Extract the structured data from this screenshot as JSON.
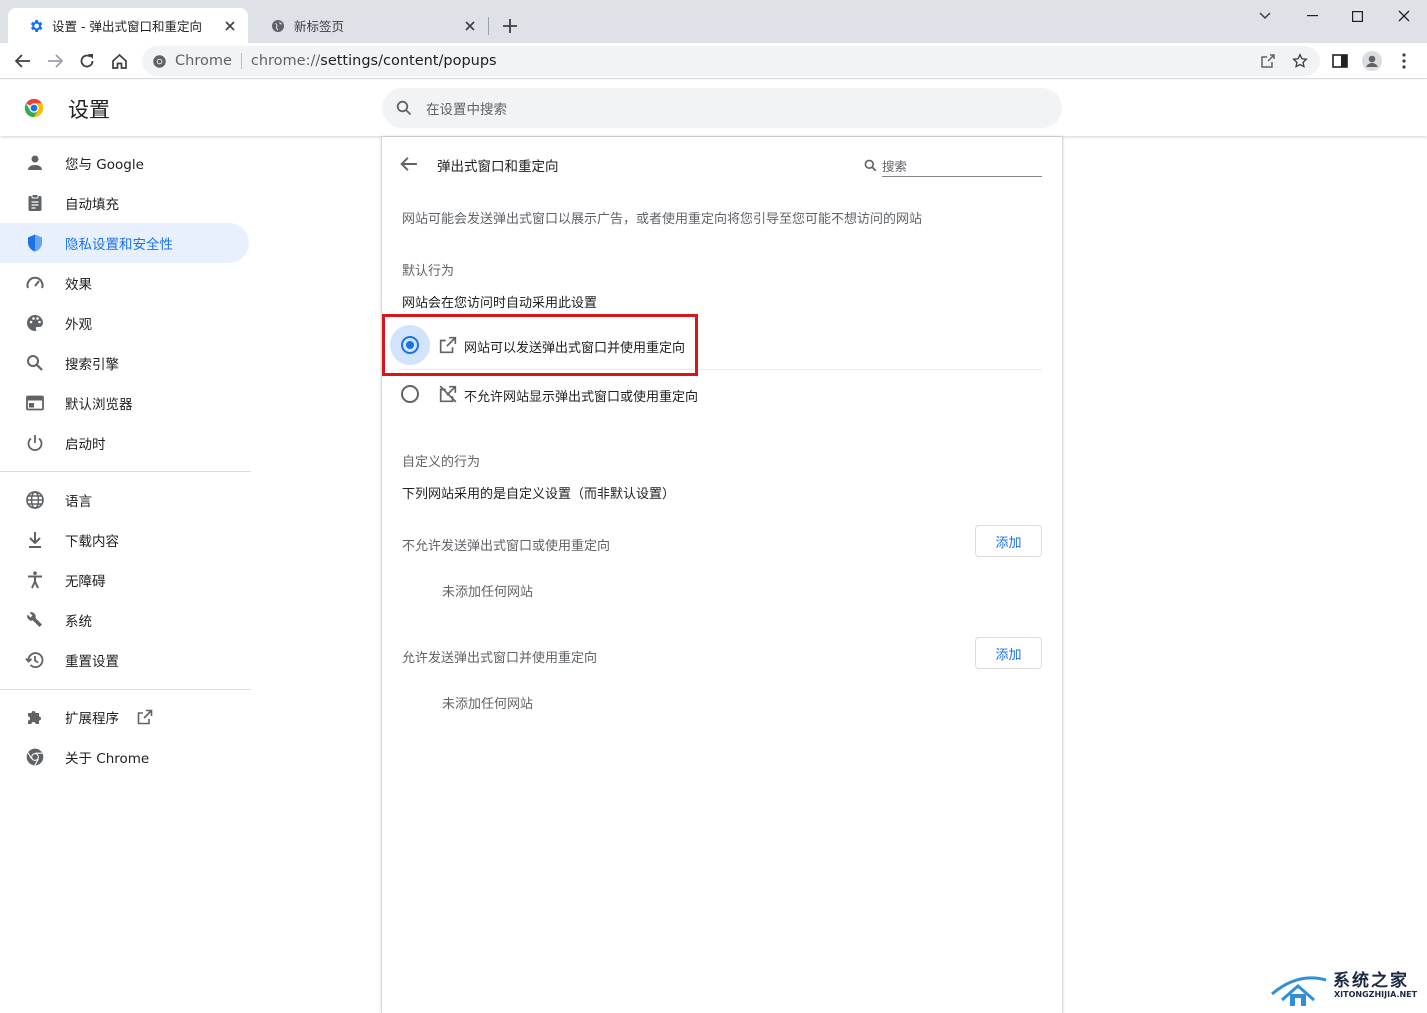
{
  "browser": {
    "tabs": [
      {
        "title": "设置 - 弹出式窗口和重定向",
        "icon": "gear-icon",
        "active": true
      },
      {
        "title": "新标签页",
        "icon": "globe-icon",
        "active": false
      }
    ],
    "omnibox": {
      "site_label": "Chrome",
      "url_prefix": "chrome://",
      "url_path": "settings/content/popups"
    }
  },
  "settings": {
    "title": "设置",
    "search_placeholder": "在设置中搜索"
  },
  "sidebar": {
    "items": [
      {
        "label": "您与 Google",
        "icon": "person-icon"
      },
      {
        "label": "自动填充",
        "icon": "clipboard-icon"
      },
      {
        "label": "隐私设置和安全性",
        "icon": "shield-icon",
        "selected": true
      },
      {
        "label": "效果",
        "icon": "speedometer-icon"
      },
      {
        "label": "外观",
        "icon": "palette-icon"
      },
      {
        "label": "搜索引擎",
        "icon": "search-icon"
      },
      {
        "label": "默认浏览器",
        "icon": "browser-icon"
      },
      {
        "label": "启动时",
        "icon": "power-icon"
      },
      {
        "label": "语言",
        "icon": "globe-icon"
      },
      {
        "label": "下载内容",
        "icon": "download-icon"
      },
      {
        "label": "无障碍",
        "icon": "accessibility-icon"
      },
      {
        "label": "系统",
        "icon": "wrench-icon"
      },
      {
        "label": "重置设置",
        "icon": "history-icon"
      },
      {
        "label": "扩展程序",
        "icon": "puzzle-icon"
      },
      {
        "label": "关于 Chrome",
        "icon": "chrome-icon"
      }
    ]
  },
  "page": {
    "title": "弹出式窗口和重定向",
    "search_placeholder": "搜索",
    "description": "网站可能会发送弹出式窗口以展示广告，或者使用重定向将您引导至您可能不想访问的网站",
    "default_behavior": {
      "heading": "默认行为",
      "subheading": "网站会在您访问时自动采用此设置",
      "options": [
        {
          "label": "网站可以发送弹出式窗口并使用重定向",
          "icon": "open-external-icon",
          "selected": true
        },
        {
          "label": "不允许网站显示弹出式窗口或使用重定向",
          "icon": "popup-blocked-icon",
          "selected": false
        }
      ]
    },
    "custom_behavior": {
      "heading": "自定义的行为",
      "subheading": "下列网站采用的是自定义设置（而非默认设置）",
      "blocked": {
        "label": "不允许发送弹出式窗口或使用重定向",
        "add": "添加",
        "empty": "未添加任何网站"
      },
      "allowed": {
        "label": "允许发送弹出式窗口并使用重定向",
        "add": "添加",
        "empty": "未添加任何网站"
      }
    }
  },
  "watermark": {
    "text": "系统之家",
    "sub": "XITONGZHIJIA.NET"
  },
  "colors": {
    "accent": "#1a73e8",
    "highlight": "#d6161d",
    "selected_bg": "#e8f0fe"
  }
}
